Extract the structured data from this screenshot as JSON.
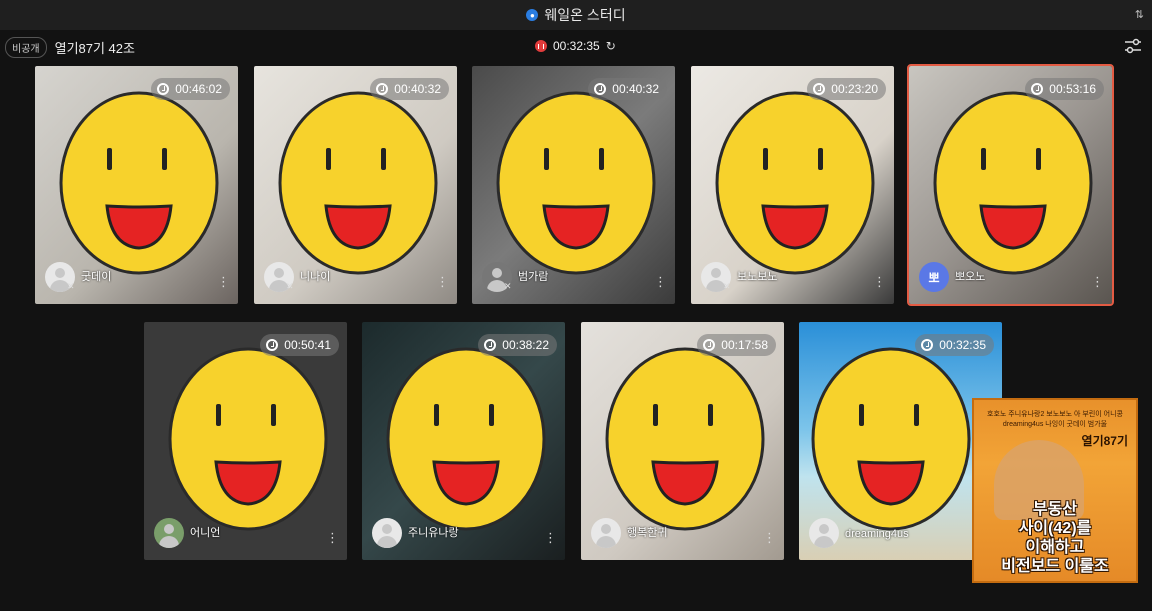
{
  "window": {
    "app_icon": "zoom-logo-icon",
    "title": "웨일온 스터디"
  },
  "toolbar": {
    "visibility_badge": "비공개",
    "room_name": "열기87기 42조",
    "elapsed": "00:32:35"
  },
  "participants_row1": [
    {
      "name": "굿데이",
      "time": "00:46:02"
    },
    {
      "name": "니나이",
      "time": "00:40:32"
    },
    {
      "name": "범가람",
      "time": "00:40:32"
    },
    {
      "name": "보노보노",
      "time": "00:23:20"
    },
    {
      "name": "뽀오노",
      "time": "00:53:16",
      "avatar_letter": "뽀"
    }
  ],
  "participants_row2": [
    {
      "name": "어니언",
      "time": "00:50:41"
    },
    {
      "name": "주니유나랑",
      "time": "00:38:22"
    },
    {
      "name": "행복한귀",
      "time": "00:17:58"
    },
    {
      "name": "dreaming4us",
      "time": "00:32:35"
    }
  ],
  "poster": {
    "subtitle": "호호노 주니유나랑2 보노보노 아 부린이 어니콩 dreaming4us 나잉이 굿데이 범가울",
    "generation": "열기87기",
    "headline_1": "부동산",
    "headline_2": "사이(42)를",
    "headline_3": "이해하고",
    "headline_4": "비전보드 이룰조"
  },
  "colors": {
    "background": "#121212",
    "accent_red": "#e23c3c",
    "active_border": "#e35b43"
  }
}
